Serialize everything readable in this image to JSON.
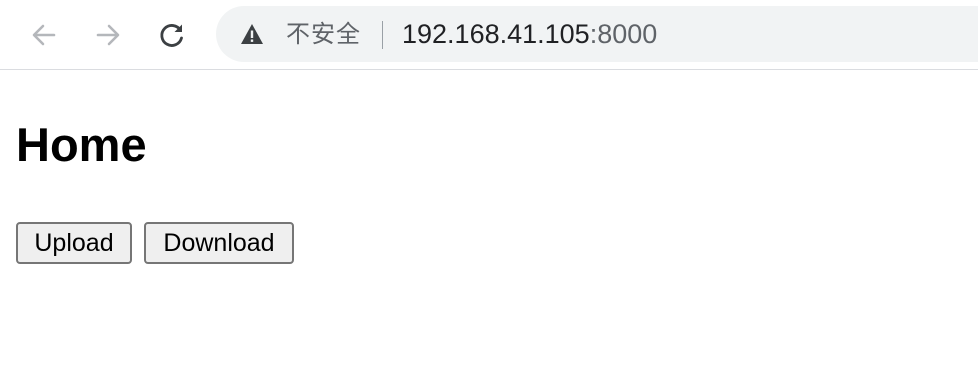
{
  "browser": {
    "security_label": "不安全",
    "url_host": "192.168.41.105",
    "url_port": ":8000",
    "icons": {
      "back": "arrow-left-icon",
      "forward": "arrow-right-icon",
      "reload": "reload-icon",
      "security": "warning-triangle-icon"
    }
  },
  "page": {
    "heading": "Home",
    "buttons": {
      "upload": "Upload",
      "download": "Download"
    }
  }
}
